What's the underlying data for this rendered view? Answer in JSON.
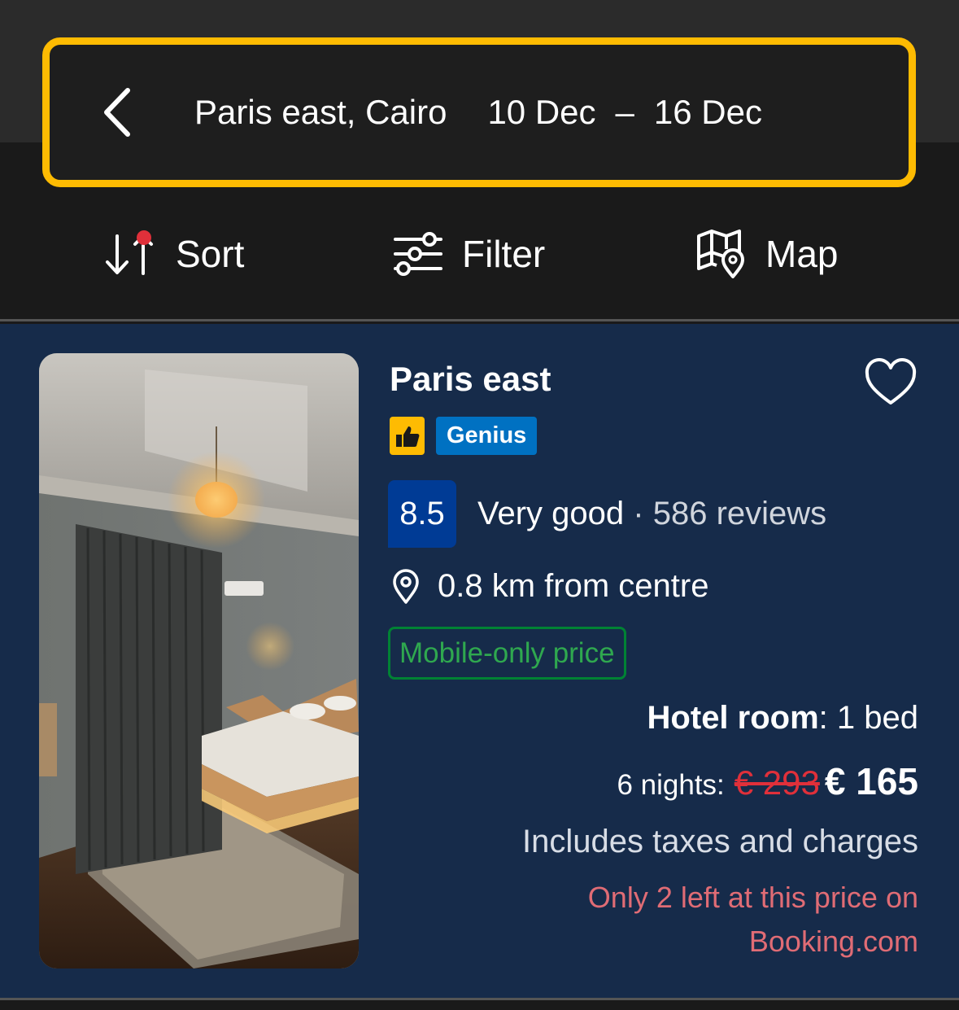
{
  "search": {
    "location": "Paris east, Cairo",
    "date_from": "10 Dec",
    "date_sep": "–",
    "date_to": "16 Dec"
  },
  "toolbar": {
    "sort_label": "Sort",
    "filter_label": "Filter",
    "map_label": "Map"
  },
  "property": {
    "name": "Paris east",
    "genius_label": "Genius",
    "score": "8.5",
    "score_word": "Very good",
    "score_sep": "·",
    "reviews": "586 reviews",
    "distance": "0.8 km from centre",
    "mobile_badge": "Mobile-only price",
    "room_type": "Hotel room",
    "room_detail": ": 1 bed",
    "nights": "6 nights:",
    "old_price": "€ 293",
    "new_price": "€ 165",
    "taxes": "Includes taxes and charges",
    "scarcity_line1": "Only 2 left at this price on",
    "scarcity_line2": "Booking.com"
  },
  "colors": {
    "accent_yellow": "#febb02",
    "card_bg": "#162b4a",
    "score_blue": "#003b95",
    "genius_blue": "#0071c2",
    "mobile_green": "#008234",
    "strike_red": "#e0303a",
    "scarcity_red": "#e06c75"
  },
  "icons": {
    "back": "chevron-left-icon",
    "sort": "sort-icon",
    "filter": "sliders-icon",
    "map": "map-icon",
    "favorite": "heart-icon",
    "thumb": "thumbs-up-icon",
    "location": "location-pin-icon"
  }
}
